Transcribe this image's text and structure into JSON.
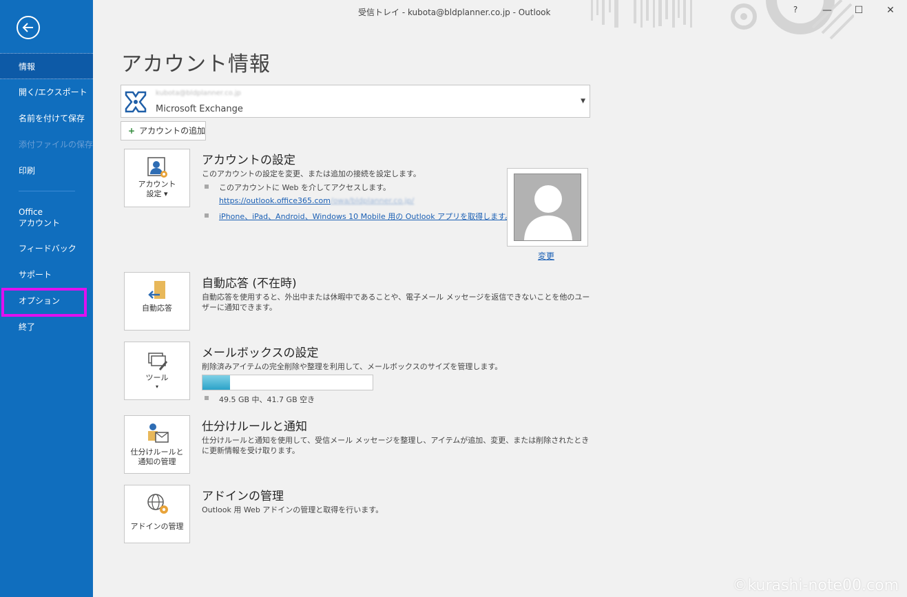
{
  "window": {
    "title": "受信トレイ - kubota@bldplanner.co.jp  -  Outlook",
    "help": "?",
    "minimize": "—",
    "maximize": "☐",
    "close": "✕"
  },
  "sidebar": {
    "items": [
      {
        "label": "情報",
        "state": "active"
      },
      {
        "label": "開く/エクスポート",
        "state": "normal"
      },
      {
        "label": "名前を付けて保存",
        "state": "normal"
      },
      {
        "label": "添付ファイルの保存",
        "state": "disabled"
      },
      {
        "label": "印刷",
        "state": "normal"
      },
      {
        "label": "Office\nアカウント",
        "state": "normal"
      },
      {
        "label": "フィードバック",
        "state": "normal"
      },
      {
        "label": "サポート",
        "state": "normal"
      },
      {
        "label": "オプション",
        "state": "highlighted"
      },
      {
        "label": "終了",
        "state": "normal"
      }
    ],
    "highlight_color": "#e010f0",
    "background_color": "#106ebe"
  },
  "page": {
    "title": "アカウント情報"
  },
  "account": {
    "email_blurred": "kubota@bldplanner.co.jp",
    "type": "Microsoft Exchange",
    "add_button": "アカウントの追加"
  },
  "sections": {
    "settings": {
      "tile_label_1": "アカウント",
      "tile_label_2": "設定 ▾",
      "title": "アカウントの設定",
      "desc": "このアカウントの設定を変更、または追加の接続を設定します。",
      "bullet1": "このアカウントに Web を介してアクセスします。",
      "link1": "https://outlook.office365.com",
      "link1_blurred": "/owa/bldplanner.co.jp/",
      "link2": "iPhone、iPad、Android、Windows 10 Mobile 用の Outlook アプリを取得します。",
      "change": "変更"
    },
    "auto_reply": {
      "tile_label": "自動応答",
      "title": "自動応答 (不在時)",
      "desc": "自動応答を使用すると、外出中または休暇中であることや、電子メール メッセージを返信できないことを他のユーザーに通知できます。"
    },
    "mailbox": {
      "tile_label_1": "ツール",
      "tile_label_2": "▾",
      "title": "メールボックスの設定",
      "desc": "削除済みアイテムの完全削除や整理を利用して、メールボックスのサイズを管理します。",
      "usage_fraction": 0.16,
      "usage_text": "49.5 GB 中、41.7 GB 空き"
    },
    "rules": {
      "tile_label_1": "仕分けルールと",
      "tile_label_2": "通知の管理",
      "title": "仕分けルールと通知",
      "desc": "仕分けルールと通知を使用して、受信メール メッセージを整理し、アイテムが追加、変更、または削除されたときに更新情報を受け取ります。"
    },
    "addins": {
      "tile_label": "アドインの管理",
      "title": "アドインの管理",
      "desc": "Outlook 用 Web アドインの管理と取得を行います。"
    }
  },
  "watermark": "©kurashi-note00.com"
}
